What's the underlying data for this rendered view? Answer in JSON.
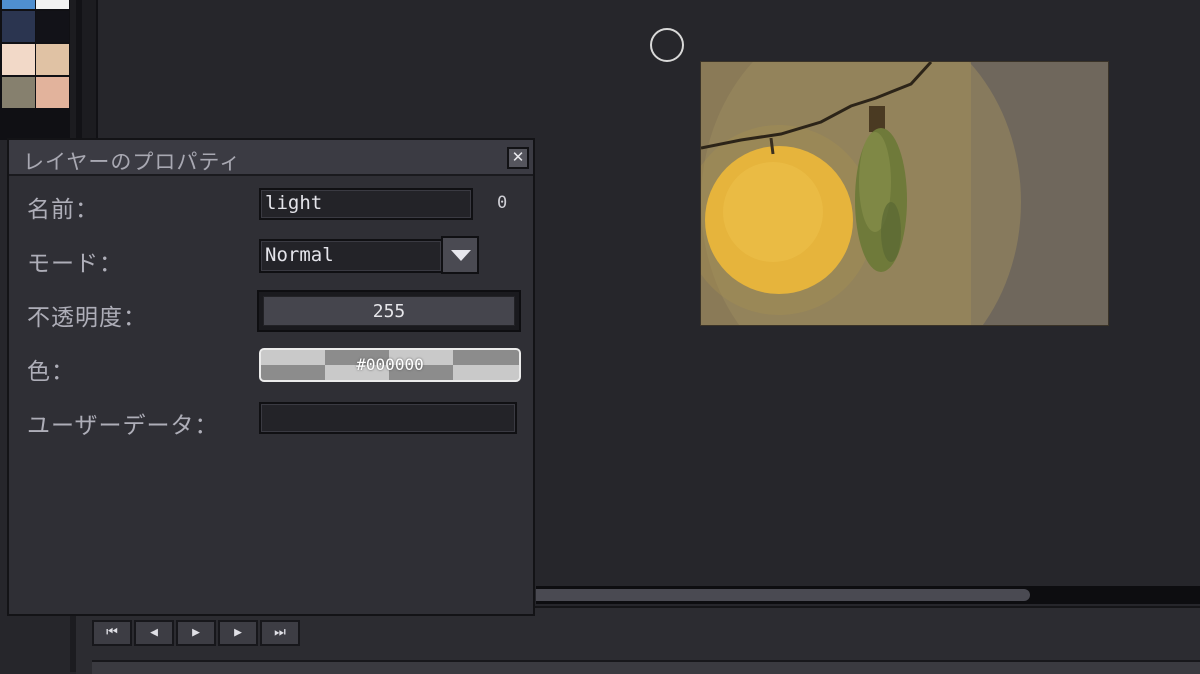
{
  "palette": {
    "swatches": [
      "#4f8fd0",
      "#f2f2f2",
      "#2b3550",
      "#121218",
      "#f2d9c8",
      "#e0c2a4",
      "#86806e",
      "#e2b39c"
    ]
  },
  "dialog": {
    "title": "レイヤーのプロパティ",
    "close_icon": "close-icon",
    "fields": {
      "name_label": "名前：",
      "name_value": "light",
      "name_counter": "0",
      "mode_label": "モード：",
      "mode_value": "Normal",
      "opacity_label": "不透明度：",
      "opacity_value": "255",
      "color_label": "色：",
      "color_value": "#000000",
      "user_data_label": "ユーザーデータ：",
      "user_data_value": ""
    }
  },
  "timeline": {
    "buttons": [
      {
        "name": "first-frame",
        "glyph": "⏮"
      },
      {
        "name": "previous-frame",
        "glyph": "◀"
      },
      {
        "name": "play",
        "glyph": "▶"
      },
      {
        "name": "next-frame",
        "glyph": "▶"
      },
      {
        "name": "last-frame",
        "glyph": "⏭"
      }
    ]
  },
  "colors": {
    "background": "#26262b",
    "dialog": "#2f2f35",
    "artwork_bg": "#8a7a57",
    "light_glow": "#e6b43c"
  }
}
